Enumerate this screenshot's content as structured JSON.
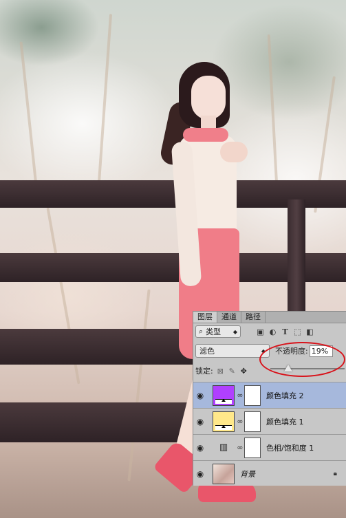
{
  "panel": {
    "tabs": [
      {
        "label": "图层",
        "active": true
      },
      {
        "label": "通道",
        "active": false
      },
      {
        "label": "路径",
        "active": false
      }
    ],
    "filter": {
      "kind_label": "类型",
      "icons": [
        "image-filter-icon",
        "adjustment-filter-icon",
        "type-filter-icon",
        "shape-filter-icon",
        "smart-object-filter-icon"
      ]
    },
    "blend_mode": "滤色",
    "opacity_label": "不透明度:",
    "opacity_value": "19%",
    "opacity_fraction": 0.19,
    "lock_label": "锁定:",
    "layers": [
      {
        "name": "颜色填充 2",
        "thumb_color": "#b040ff",
        "type": "fill",
        "selected": true
      },
      {
        "name": "颜色填充 1",
        "thumb_color": "#ffe88a",
        "type": "fill",
        "selected": false
      },
      {
        "name": "色相/饱和度 1",
        "type": "adjustment",
        "selected": false
      },
      {
        "name": "背景",
        "type": "background",
        "selected": false
      }
    ]
  },
  "colors": {
    "panel_bg": "#c7c7c7",
    "selection": "#a6b8dc",
    "highlight_ring": "#d8121a"
  }
}
